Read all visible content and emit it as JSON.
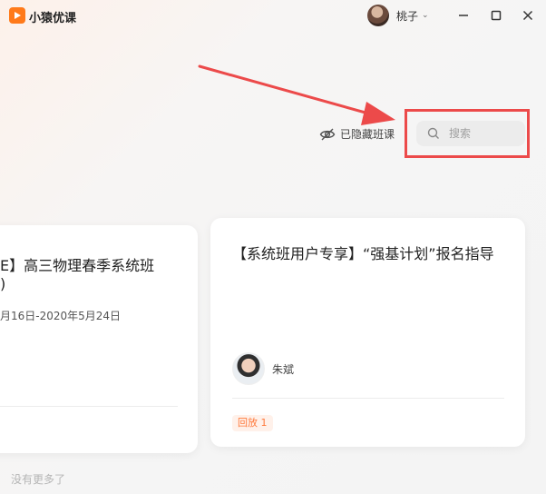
{
  "app": {
    "name": "小猿优课",
    "logo_icon": "play-logo-icon",
    "brand_color": "#ff7a1a"
  },
  "user": {
    "name": "桃子"
  },
  "window_controls": [
    "minimize-icon",
    "maximize-icon",
    "close-icon"
  ],
  "toolbar": {
    "hidden_classes_label": "已隐藏班课",
    "search_placeholder": "搜索"
  },
  "annotation": {
    "color": "#ec4a4a"
  },
  "courses": [
    {
      "title_line1": "E】高三物理春季系统班",
      "title_line2": ")",
      "date": "月16日-2020年5月24日"
    },
    {
      "title": "【系统班用户专享】“强基计划”报名指导",
      "teacher": "朱斌",
      "badge": "回放 1"
    }
  ],
  "footer": {
    "no_more": "没有更多了"
  }
}
